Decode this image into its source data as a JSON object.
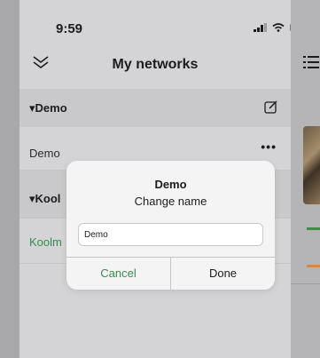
{
  "status": {
    "time": "9:59"
  },
  "header": {
    "title": "My networks"
  },
  "groups": [
    {
      "name": "▾Demo",
      "items": [
        {
          "label": "Demo",
          "more": "•••"
        }
      ]
    },
    {
      "name": "▾Kool",
      "items": [
        {
          "label": "Koolm"
        }
      ]
    }
  ],
  "dialog": {
    "title": "Demo",
    "message": "Change name",
    "input_value": "Demo",
    "cancel_label": "Cancel",
    "done_label": "Done"
  },
  "colors": {
    "accent_green": "#3a8a4f",
    "accent_orange": "#d8893b"
  }
}
